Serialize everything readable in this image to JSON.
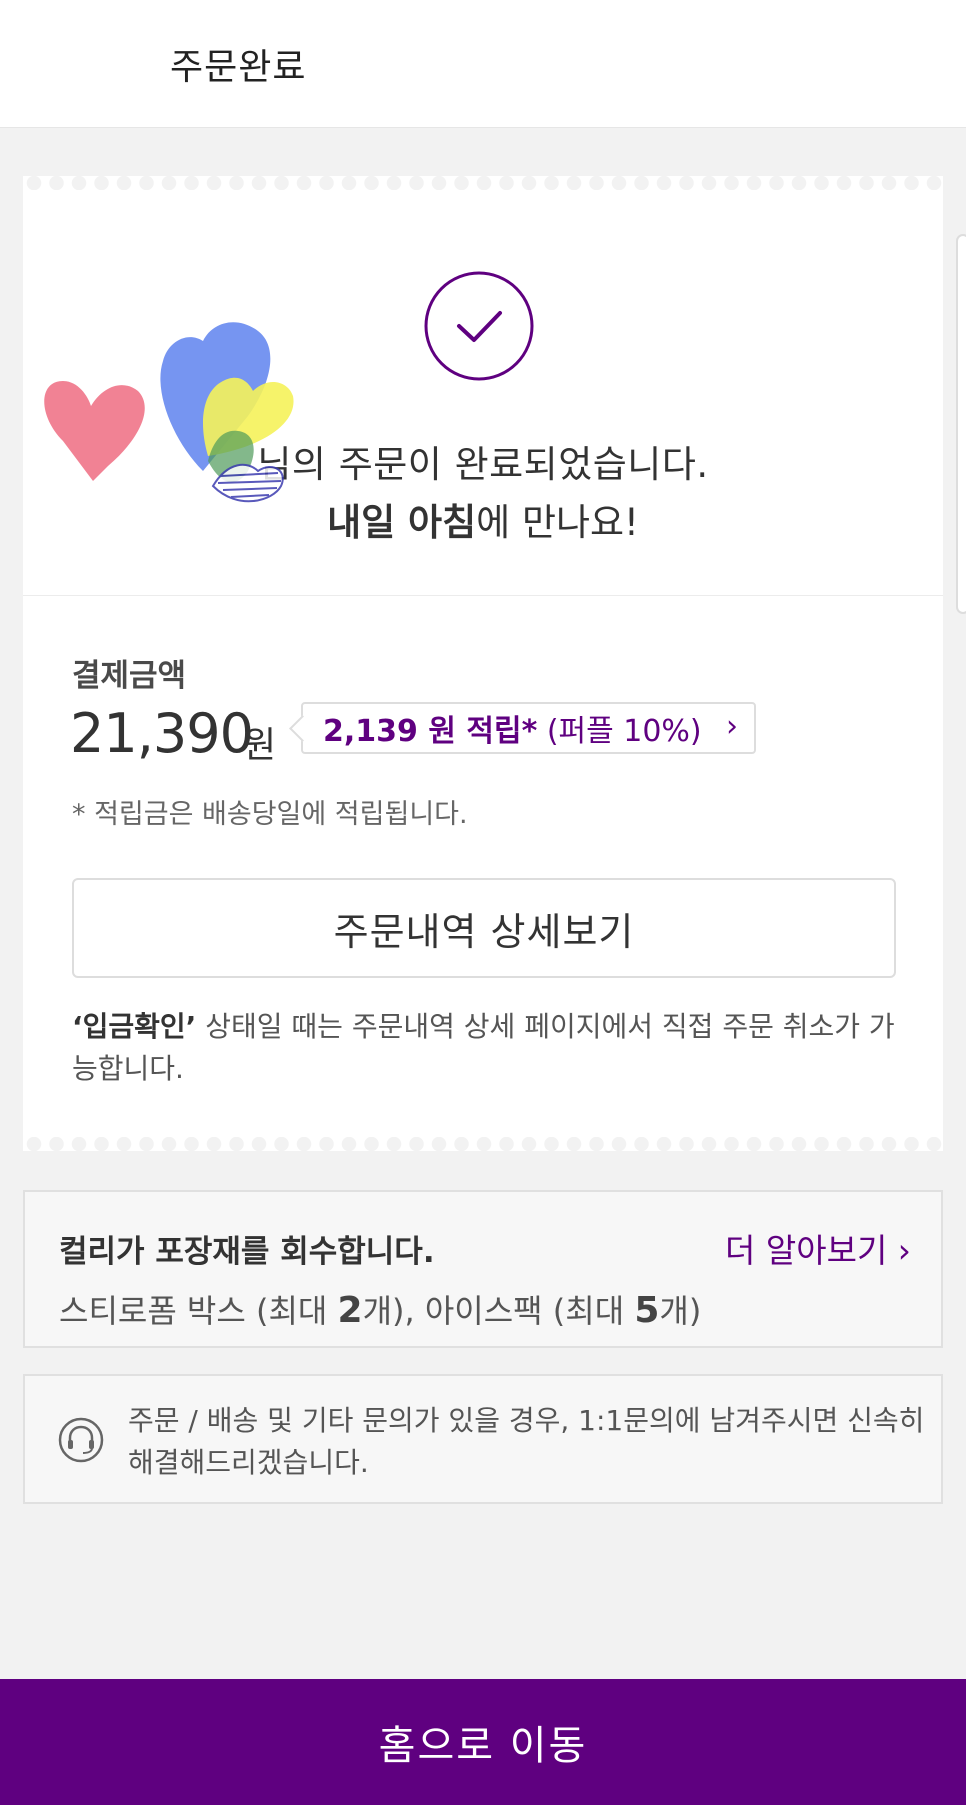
{
  "header": {
    "title": "주문완료"
  },
  "complete": {
    "message_line1": "님의 주문이 완료되었습니다.",
    "message_line2_bold": "내일 아침",
    "message_line2_rest": "에 만나요!"
  },
  "payment": {
    "label": "결제금액",
    "amount": "21,390",
    "unit": "원",
    "points_bold": "2,139 원 적립*",
    "points_rest": " (퍼플 10%)",
    "points_chevron": "›",
    "points_note": "* 적립금은 배송당일에 적립됩니다."
  },
  "order_detail_button": "주문내역 상세보기",
  "cancel_note": {
    "bold": "‘입금확인’",
    "rest": " 상태일 때는 주문내역 상세 페이지에서 직접 주문 취소가 가능합니다."
  },
  "collect": {
    "title": "컬리가 포장재를 회수합니다.",
    "more": "더 알아보기 ›",
    "desc_part1": "스티로폼 박스 (최대 ",
    "desc_num1": "2",
    "desc_part2": "개), 아이스팩 (최대 ",
    "desc_num2": "5",
    "desc_part3": "개)"
  },
  "inquiry": {
    "icon": "headset-icon",
    "text": "주문 / 배송 및 기타 문의가 있을 경우, 1:1문의에 남겨주시면 신속히 해결해드리겠습니다."
  },
  "home_button": "홈으로 이동",
  "colors": {
    "brand": "#5f0080",
    "pink": "#f07b8e",
    "blue": "#6f8ff0",
    "yellow": "#f5f25a"
  }
}
